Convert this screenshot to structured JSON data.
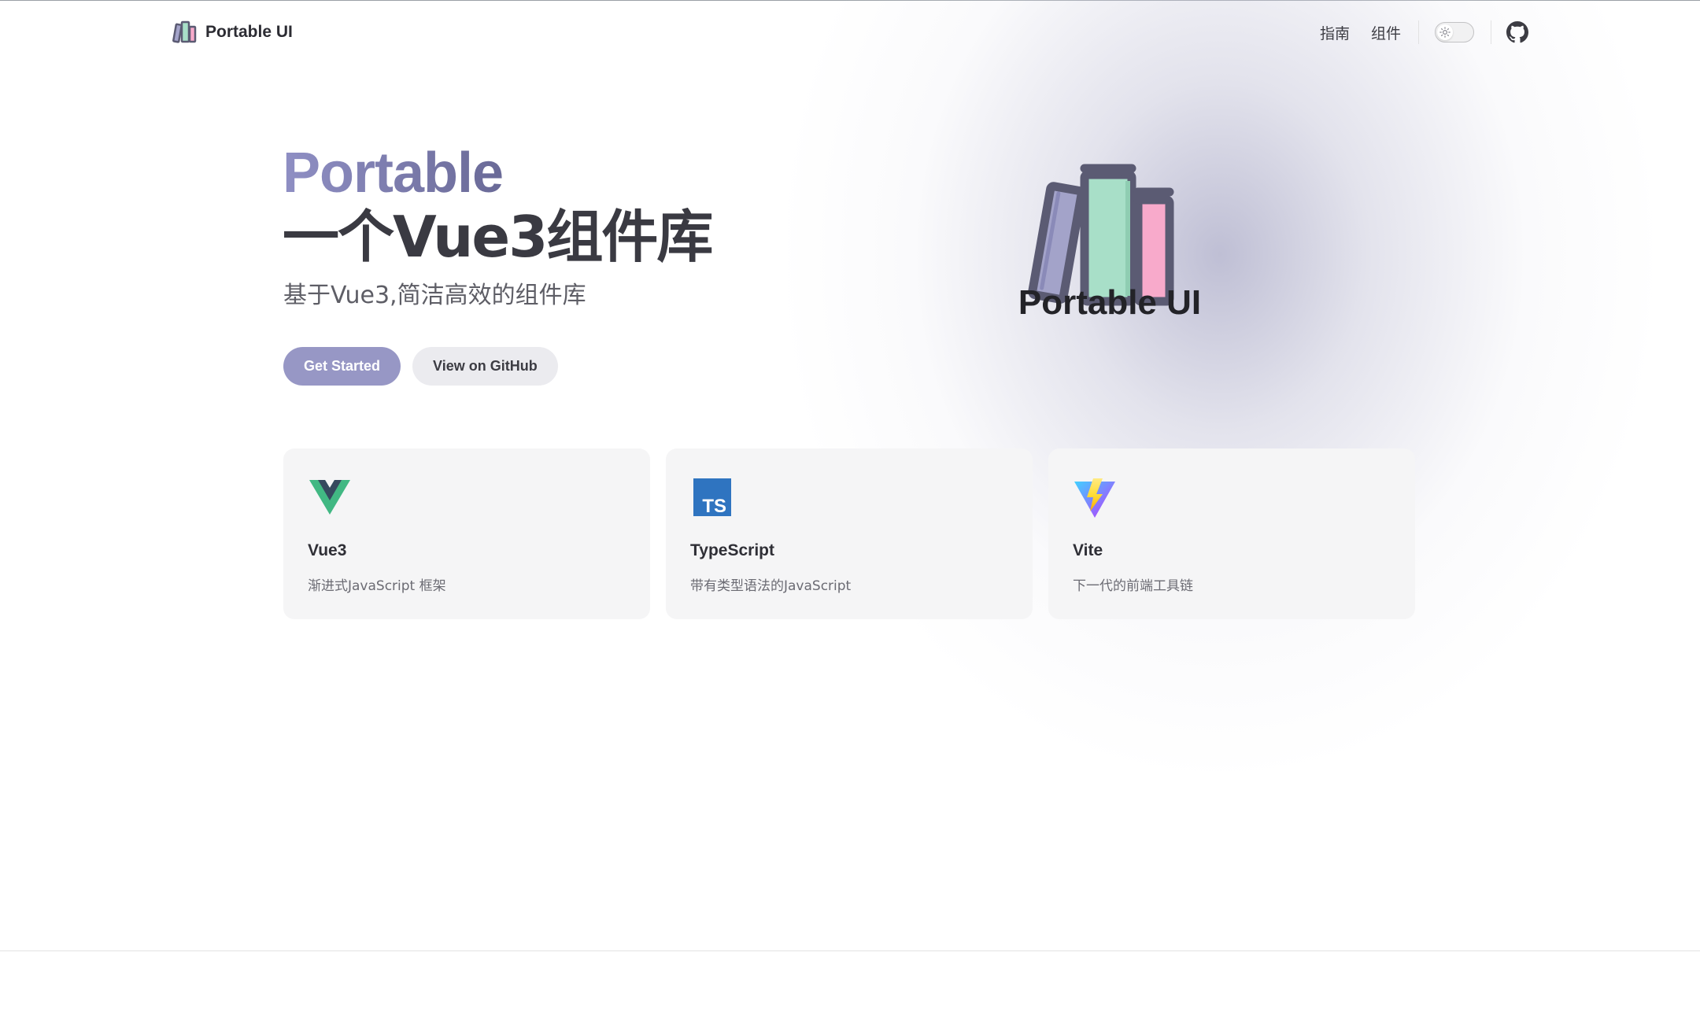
{
  "nav": {
    "title": "Portable UI",
    "links": [
      {
        "label": "指南"
      },
      {
        "label": "组件"
      }
    ],
    "theme_toggle": {
      "state": "light",
      "icon": "sun-icon"
    },
    "github": {
      "icon": "github-icon"
    }
  },
  "hero": {
    "name": "Portable",
    "text": "一个Vue3组件库",
    "tagline": "基于Vue3,简洁高效的组件库",
    "actions": [
      {
        "label": "Get Started",
        "theme": "brand"
      },
      {
        "label": "View on GitHub",
        "theme": "alt"
      }
    ],
    "image_title": "Portable UI"
  },
  "features": [
    {
      "icon": "vue-logo-icon",
      "title": "Vue3",
      "details": "渐进式JavaScript 框架"
    },
    {
      "icon": "typescript-logo-icon",
      "title": "TypeScript",
      "details": "带有类型语法的JavaScript"
    },
    {
      "icon": "vite-logo-icon",
      "title": "Vite",
      "details": "下一代的前端工具链"
    }
  ],
  "colors": {
    "brand": "#9797c5",
    "brand_dark": "#6a6a97",
    "book_purple": "#a3a3c9",
    "book_green": "#a8dfc8",
    "book_pink": "#f8aacb",
    "book_outline": "#5b5b73"
  }
}
